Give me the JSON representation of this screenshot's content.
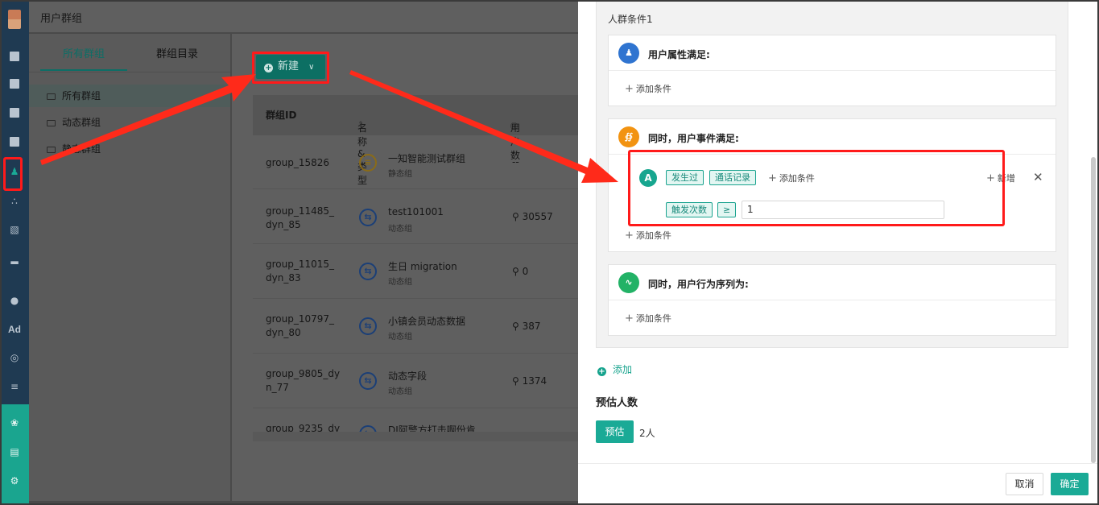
{
  "app": {
    "title": "用户群组"
  },
  "sidebar": {
    "tabs": [
      "所有群组",
      "群组目录"
    ],
    "items": [
      "所有群组",
      "动态群组",
      "静态群组"
    ]
  },
  "toolbar": {
    "new_label": "新建"
  },
  "table": {
    "headers": {
      "id": "群组ID",
      "name_type": "名称&类型",
      "users": "用户数"
    },
    "rows": [
      {
        "id": "group_15826",
        "name": "一知智能测试群组",
        "type": "静态组",
        "count": "--",
        "kind": "static"
      },
      {
        "id": "group_11485_dyn_85",
        "id_l1": "group_11485_",
        "id_l2": "dyn_85",
        "name": "test101001",
        "type": "动态组",
        "count": "30557",
        "kind": "dynamic"
      },
      {
        "id": "group_11015_dyn_83",
        "id_l1": "group_11015_",
        "id_l2": "dyn_83",
        "name": "生日 migration",
        "type": "动态组",
        "count": "0",
        "kind": "dynamic"
      },
      {
        "id": "group_10797_dyn_80",
        "id_l1": "group_10797_",
        "id_l2": "dyn_80",
        "name": "小镇会员动态数据",
        "type": "动态组",
        "count": "387",
        "kind": "dynamic"
      },
      {
        "id": "group_9805_dyn_77",
        "id_l1": "group_9805_dy",
        "id_l2": "n_77",
        "name": "动态字段",
        "type": "动态组",
        "count": "1374",
        "kind": "dynamic"
      },
      {
        "id": "group_9235_dy",
        "name": "DJ阿警方打击啊份肯...",
        "type": "",
        "count": "",
        "kind": "dynamic"
      }
    ]
  },
  "drawer": {
    "group_title": "人群条件1",
    "cards": {
      "attr": {
        "title": "用户属性满足:",
        "add": "添加条件"
      },
      "event": {
        "title": "同时，用户事件满足:",
        "badge": "A",
        "tag_did": "发生过",
        "tag_event": "通话记录",
        "add_inner": "添加条件",
        "new_label": "新增",
        "metric": "触发次数",
        "op": "≥",
        "value": "1",
        "add": "添加条件"
      },
      "seq": {
        "title": "同时，用户行为序列为:",
        "add": "添加条件"
      }
    },
    "add_label": "添加",
    "estimate": {
      "title": "预估人数",
      "button": "预估",
      "value": "2人"
    },
    "footer": {
      "cancel": "取消",
      "ok": "确定"
    }
  },
  "colors": {
    "accent": "#1aaa96",
    "annotation_red": "#ff1a1a",
    "rail": "#1f3a52"
  }
}
